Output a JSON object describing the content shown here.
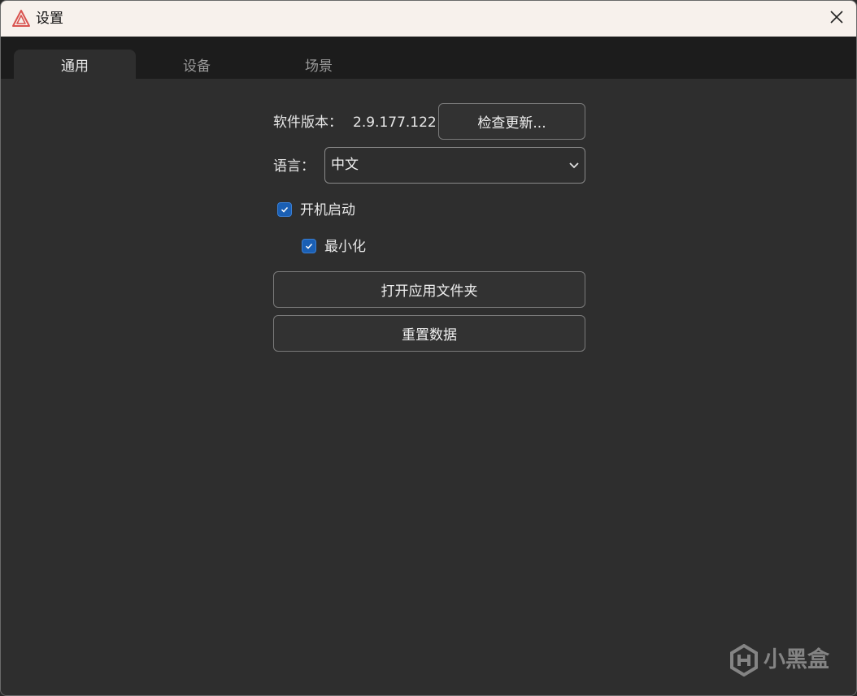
{
  "window": {
    "title": "设置",
    "app_icon": "app-logo-icon",
    "close_icon": "close-icon"
  },
  "tabs": [
    {
      "label": "通用",
      "active": true
    },
    {
      "label": "设备",
      "active": false
    },
    {
      "label": "场景",
      "active": false
    }
  ],
  "general": {
    "version_label": "软件版本：",
    "version_value": "2.9.177.122",
    "check_update_label": "检查更新...",
    "language_label": "语言：",
    "language_selected": "中文",
    "startup_label": "开机启动",
    "startup_checked": true,
    "minimize_label": "最小化",
    "minimize_checked": true,
    "open_folder_label": "打开应用文件夹",
    "reset_data_label": "重置数据"
  },
  "watermark": {
    "text": "小黑盒",
    "icon": "heybox-logo-icon"
  },
  "colors": {
    "accent": "#1a5fb4",
    "titlebar": "#f7f1ec",
    "background": "#2e2e2e",
    "tabbar": "#1c1c1c"
  }
}
